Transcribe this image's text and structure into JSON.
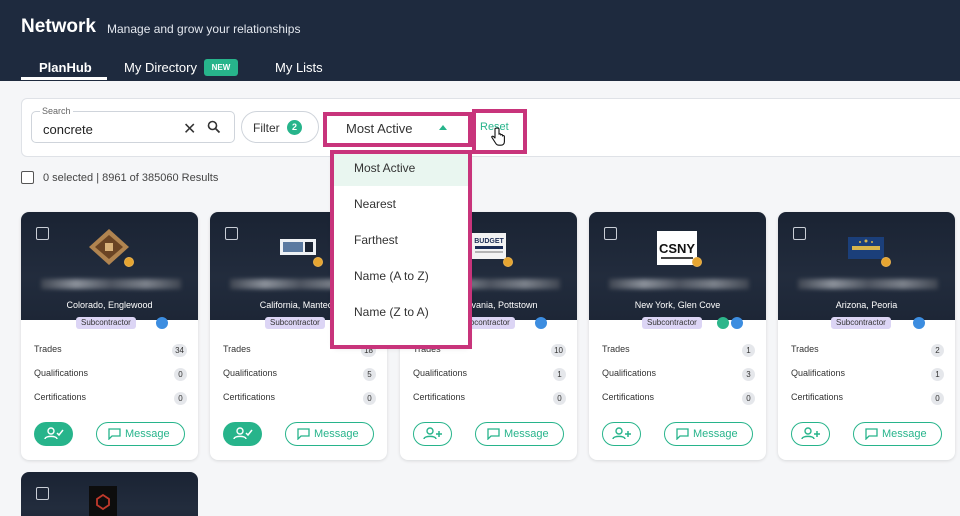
{
  "header": {
    "title": "Network",
    "subtitle": "Manage and grow your relationships",
    "tabs": [
      {
        "label": "PlanHub"
      },
      {
        "label": "My Directory",
        "badge": "NEW"
      },
      {
        "label": "My Lists"
      }
    ]
  },
  "search": {
    "label": "Search",
    "value": "concrete",
    "clear_glyph": "✕"
  },
  "filter": {
    "label": "Filter",
    "count": "2"
  },
  "sort": {
    "selected": "Most Active",
    "options": [
      "Most Active",
      "Nearest",
      "Farthest",
      "Name (A to Z)",
      "Name (Z to A)"
    ]
  },
  "reset_label": "Reset",
  "results": {
    "text": "0 selected | 8961 of 385060 Results"
  },
  "stat_labels": {
    "trades": "Trades",
    "qualifications": "Qualifications",
    "certifications": "Certifications"
  },
  "message_label": "Message",
  "colors": {
    "accent": "#27b48b",
    "highlight": "#c8347b",
    "header_bg": "#1e2a3e",
    "type_badge": "#dcd5f5"
  },
  "cards": [
    {
      "location": "Colorado, Englewood",
      "type": "Subcontractor",
      "trades": "34",
      "qualifications": "0",
      "certifications": "0",
      "connected": true
    },
    {
      "location": "California, Manteca",
      "type": "Subcontractor",
      "trades": "18",
      "qualifications": "5",
      "certifications": "0",
      "connected": true
    },
    {
      "location": "Pennsylvania, Pottstown",
      "type": "Subcontractor",
      "logo_text": "BUDGET",
      "trades": "10",
      "qualifications": "1",
      "certifications": "0",
      "connected": false
    },
    {
      "location": "New York, Glen Cove",
      "type": "Subcontractor",
      "logo_text": "CSNY",
      "trades": "1",
      "qualifications": "3",
      "certifications": "0",
      "connected": false
    },
    {
      "location": "Arizona, Peoria",
      "type": "Subcontractor",
      "trades": "2",
      "qualifications": "1",
      "certifications": "0",
      "connected": false
    }
  ]
}
